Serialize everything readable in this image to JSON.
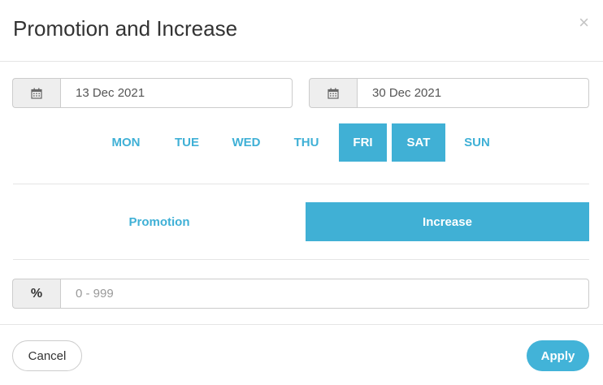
{
  "dialog": {
    "title": "Promotion and Increase",
    "close_label": "×"
  },
  "dates": {
    "start_icon": "calendar-icon",
    "start_value": "13 Dec 2021",
    "end_icon": "calendar-icon",
    "end_value": "30 Dec 2021"
  },
  "days": [
    {
      "label": "MON",
      "selected": false
    },
    {
      "label": "TUE",
      "selected": false
    },
    {
      "label": "WED",
      "selected": false
    },
    {
      "label": "THU",
      "selected": false
    },
    {
      "label": "FRI",
      "selected": true
    },
    {
      "label": "SAT",
      "selected": true
    },
    {
      "label": "SUN",
      "selected": false
    }
  ],
  "mode": {
    "promotion_label": "Promotion",
    "increase_label": "Increase",
    "selected": "Increase"
  },
  "percent": {
    "addon_label": "%",
    "placeholder": "0 - 999",
    "value": ""
  },
  "footer": {
    "cancel_label": "Cancel",
    "apply_label": "Apply"
  },
  "colors": {
    "accent": "#40b0d5",
    "accent_text": "#3fb0d6",
    "addon_bg": "#eeeeee"
  }
}
